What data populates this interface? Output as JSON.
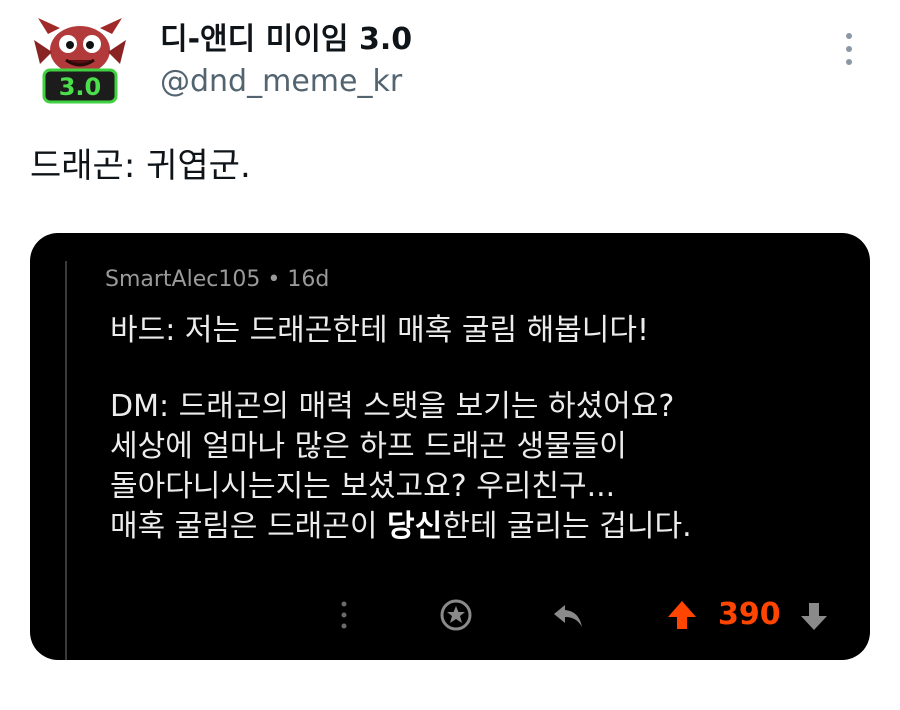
{
  "tweet": {
    "display_name": "디-앤디 미이임 3.0",
    "handle": "@dnd_meme_kr",
    "text": "드래곤: 귀엽군.",
    "avatar_badge": "3.0",
    "more_icon": "more-vertical-icon"
  },
  "reddit_comment": {
    "author": "SmartAlec105",
    "age": "16d",
    "lines": [
      "바드: 저는 드래곤한테 매혹 굴림 해봅니다!",
      "",
      "DM: 드래곤의 매력 스탯을 보기는 하셨어요?",
      "세상에 얼마나 많은 하프 드래곤 생물들이",
      "돌아다니시는지는 보셨고요? 우리친구...",
      {
        "pre": "매혹 굴림은 드래곤이 ",
        "bold": "당신",
        "post": "한테 굴리는 겁니다."
      }
    ],
    "vote_count": "390",
    "icons": [
      "more-vertical-icon",
      "award-icon",
      "reply-icon",
      "upvote-icon",
      "downvote-icon"
    ]
  },
  "colors": {
    "upvote": "#ff4500",
    "card_bg": "#000000",
    "handle": "#536471"
  }
}
